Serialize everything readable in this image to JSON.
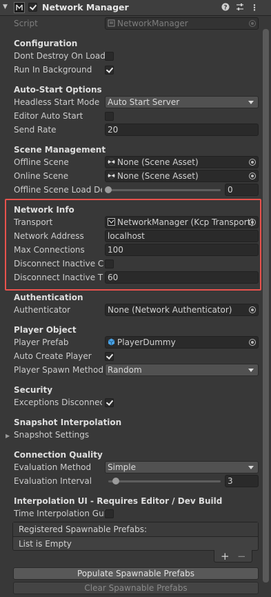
{
  "header": {
    "title": "Network Manager",
    "icons": [
      "help-icon",
      "preset-icon",
      "more-icon"
    ]
  },
  "script": {
    "label": "Script",
    "value": "NetworkManager"
  },
  "configuration": {
    "title": "Configuration",
    "dont_destroy_label": "Dont Destroy On Load",
    "dont_destroy": false,
    "run_bg_label": "Run In Background",
    "run_bg": true
  },
  "auto_start": {
    "title": "Auto-Start Options",
    "headless_label": "Headless Start Mode",
    "headless_value": "Auto Start Server",
    "editor_label": "Editor Auto Start",
    "editor_value": false,
    "send_rate_label": "Send Rate",
    "send_rate": "20"
  },
  "scene": {
    "title": "Scene Management",
    "offline_label": "Offline Scene",
    "offline_value": "None (Scene Asset)",
    "online_label": "Online Scene",
    "online_value": "None (Scene Asset)",
    "delay_label": "Offline Scene Load Del",
    "delay_value": "0",
    "delay_slider": 0
  },
  "network_info": {
    "title": "Network Info",
    "transport_label": "Transport",
    "transport_value": "NetworkManager (Kcp Transport)",
    "address_label": "Network Address",
    "address_value": "localhost",
    "max_conn_label": "Max Connections",
    "max_conn_value": "100",
    "disc_inactive_label": "Disconnect Inactive Co",
    "disc_inactive": false,
    "disc_timeout_label": "Disconnect Inactive Tir",
    "disc_timeout": "60"
  },
  "authentication": {
    "title": "Authentication",
    "auth_label": "Authenticator",
    "auth_value": "None (Network Authenticator)"
  },
  "player": {
    "title": "Player Object",
    "prefab_label": "Player Prefab",
    "prefab_value": "PlayerDummy",
    "auto_create_label": "Auto Create Player",
    "auto_create": true,
    "spawn_label": "Player Spawn Method",
    "spawn_value": "Random"
  },
  "security": {
    "title": "Security",
    "exceptions_label": "Exceptions Disconnect",
    "exceptions": true
  },
  "snapshot": {
    "title": "Snapshot Interpolation",
    "settings_label": "Snapshot Settings"
  },
  "quality": {
    "title": "Connection Quality",
    "method_label": "Evaluation Method",
    "method_value": "Simple",
    "interval_label": "Evaluation Interval",
    "interval_value": "3",
    "interval_slider": 0.07
  },
  "interp_ui": {
    "title": "Interpolation UI - Requires Editor / Dev Build",
    "gui_label": "Time Interpolation Gui",
    "gui": false
  },
  "spawnables": {
    "header": "Registered Spawnable Prefabs:",
    "empty": "List is Empty",
    "add": "+",
    "remove": "−"
  },
  "buttons": {
    "populate": "Populate Spawnable Prefabs",
    "clear": "Clear Spawnable Prefabs"
  },
  "colors": {
    "highlight": "#e8524d",
    "background": "#383838",
    "field": "#2a2a2a"
  }
}
